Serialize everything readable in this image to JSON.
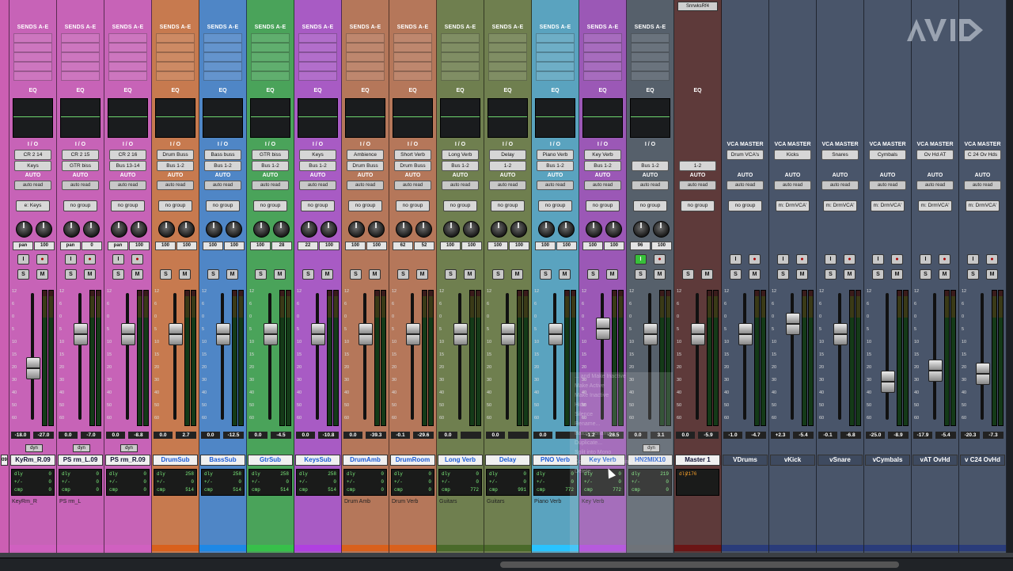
{
  "sends_label": "SENDS A-E",
  "eq_label": "EQ",
  "io_label": "I / O",
  "auto_label": "AUTO",
  "vca_master_label": "VCA MASTER",
  "solo_label": "S",
  "mute_label": "M",
  "dly_label": "dly",
  "pd_label": "+/-",
  "cmp_label": "cmp",
  "insert_label": "SnrwksRf4",
  "dyn_label": "dyn",
  "scale": [
    "12",
    "6",
    "0",
    "5",
    "10",
    "15",
    "20",
    "30",
    "40",
    "50",
    "60"
  ],
  "strips": [
    {
      "name": "09",
      "color": "#cc5fb3",
      "name_bg": "#f0f0f0",
      "kind": "partial"
    },
    {
      "name": "KyRm_R.09",
      "color": "#c763b7",
      "io": [
        "CR 2 14",
        "Keys"
      ],
      "auto": "auto read",
      "group": "e: Keys",
      "pan": [
        "pan",
        "100"
      ],
      "vol": [
        "-18.0",
        "-27.0"
      ],
      "fader": 0.58,
      "dly": [
        "dly",
        "0",
        "+/-",
        "0",
        "cmp",
        "0"
      ],
      "comment": "KeyRm_R",
      "bar": "#d060c0",
      "dyn": true
    },
    {
      "name": "PS rm_L.09",
      "color": "#c763b7",
      "io": [
        "CR 2 15",
        "GTR biss"
      ],
      "auto": "auto read",
      "group": "no group",
      "pan": [
        "pan",
        "0"
      ],
      "vol": [
        "0.0",
        "-7.0"
      ],
      "fader": 0.27,
      "dly": [
        "dly",
        "0",
        "+/-",
        "0",
        "cmp",
        "0"
      ],
      "comment": "PS rm_L",
      "bar": "#d060c0",
      "dyn": true
    },
    {
      "name": "PS rm_R.09",
      "color": "#c763b7",
      "io": [
        "CR 2 16",
        "Bus 13-14"
      ],
      "auto": "auto read",
      "group": "no group",
      "pan": [
        "pan",
        "100"
      ],
      "vol": [
        "0.0",
        "-8.8"
      ],
      "fader": 0.27,
      "dly": [
        "dly",
        "0",
        "+/-",
        "0",
        "cmp",
        "0"
      ],
      "comment": "",
      "bar": "#d060c0",
      "dyn": true
    },
    {
      "name": "DrumSub",
      "color": "#c77a4f",
      "io": [
        "Drum Buss",
        "Bus 1-2"
      ],
      "auto": "auto read",
      "group": "no group",
      "pan": [
        "100",
        "100"
      ],
      "vol": [
        "0.0",
        "2.7"
      ],
      "fader": 0.27,
      "dly": [
        "dly",
        "258",
        "+/-",
        "0",
        "cmp",
        "514"
      ],
      "comment": "",
      "bar": "#d9601c"
    },
    {
      "name": "BassSub",
      "color": "#4f86c6",
      "io": [
        "Bass buss",
        "Bus 1-2"
      ],
      "auto": "auto read",
      "group": "no group",
      "pan": [
        "100",
        "100"
      ],
      "vol": [
        "0.0",
        "-12.5"
      ],
      "fader": 0.27,
      "dly": [
        "dly",
        "258",
        "+/-",
        "0",
        "cmp",
        "514"
      ],
      "comment": "",
      "bar": "#1e88e5"
    },
    {
      "name": "GtrSub",
      "color": "#4aa35a",
      "io": [
        "GTR biss",
        "Bus 1-2"
      ],
      "auto": "auto read",
      "group": "no group",
      "pan": [
        "100",
        "28"
      ],
      "vol": [
        "0.0",
        "-4.5"
      ],
      "fader": 0.27,
      "dly": [
        "dly",
        "258",
        "+/-",
        "0",
        "cmp",
        "514"
      ],
      "comment": "",
      "bar": "#37c04a"
    },
    {
      "name": "KeysSub",
      "color": "#a85bc4",
      "io": [
        "Keys",
        "Bus 1-2"
      ],
      "auto": "auto read",
      "group": "no group",
      "pan": [
        "22",
        "100"
      ],
      "vol": [
        "0.0",
        "-10.8"
      ],
      "fader": 0.27,
      "dly": [
        "dly",
        "258",
        "+/-",
        "0",
        "cmp",
        "514"
      ],
      "comment": "",
      "bar": "#b040e0"
    },
    {
      "name": "DrumAmb",
      "color": "#b5775a",
      "io": [
        "Ambience",
        "Drum Buss"
      ],
      "auto": "auto read",
      "group": "no group",
      "pan": [
        "100",
        "100"
      ],
      "vol": [
        "0.0",
        "-39.3"
      ],
      "fader": 0.27,
      "dly": [
        "dly",
        "0",
        "+/-",
        "0",
        "cmp",
        "0"
      ],
      "comment": "Drum Amb",
      "bar": "#d9601c"
    },
    {
      "name": "DrumRoom",
      "color": "#b5775a",
      "io": [
        "Short Verb",
        "Drum Buss"
      ],
      "auto": "auto read",
      "group": "no group",
      "pan": [
        "62",
        "52"
      ],
      "vol": [
        "-0.1",
        "-29.6"
      ],
      "fader": 0.27,
      "dly": [
        "dly",
        "0",
        "+/-",
        "0",
        "cmp",
        "0"
      ],
      "comment": "Drum Verb",
      "bar": "#d9601c"
    },
    {
      "name": "Long Verb",
      "color": "#6f7f4f",
      "io": [
        "Long Verb",
        "Bus 1-2"
      ],
      "auto": "auto read",
      "group": "no group",
      "pan": [
        "100",
        "100"
      ],
      "vol": [
        "0.0",
        ""
      ],
      "fader": 0.27,
      "dly": [
        "dly",
        "0",
        "+/-",
        "0",
        "cmp",
        "772"
      ],
      "comment": "Guitars",
      "bar": "#4a6a2a"
    },
    {
      "name": "Delay",
      "color": "#6f7f4f",
      "io": [
        "Delay",
        "1-2"
      ],
      "auto": "auto read",
      "group": "no group",
      "pan": [
        "100",
        "100"
      ],
      "vol": [
        "0.0",
        ""
      ],
      "fader": 0.27,
      "dly": [
        "dly",
        "0",
        "+/-",
        "0",
        "cmp",
        "991"
      ],
      "comment": "Guitars",
      "bar": "#4a6a2a"
    },
    {
      "name": "PNO Verb",
      "color": "#5aa3bf",
      "io": [
        "Piano Verb",
        "Bus 1-2"
      ],
      "auto": "auto read",
      "group": "no group",
      "pan": [
        "100",
        "100"
      ],
      "vol": [
        "0.0",
        ""
      ],
      "fader": 0.27,
      "dly": [
        "dly",
        "0",
        "+/-",
        "0",
        "cmp",
        "772"
      ],
      "comment": "Piano Verb",
      "bar": "#29c3ff"
    },
    {
      "name": "Key Verb",
      "color": "#9b58b6",
      "io": [
        "Key Verb",
        "Bus 1-2"
      ],
      "auto": "auto read",
      "group": "no group",
      "pan": [
        "100",
        "100"
      ],
      "vol": [
        "-1.2",
        "-28.5"
      ],
      "fader": 0.22,
      "dly": [
        "dly",
        "0",
        "+/-",
        "0",
        "cmp",
        "772"
      ],
      "comment": "Key Verb",
      "bar": "#b040e0"
    },
    {
      "name": "HN2MIX10",
      "color": "#56606b",
      "io": [
        "",
        "Bus 1-2"
      ],
      "auto": "auto read",
      "group": "no group",
      "pan": [
        "96",
        "100"
      ],
      "vol": [
        "0.0",
        "3.1"
      ],
      "fader": 0.27,
      "dly": [
        "dly",
        "219",
        "+/-",
        "0",
        "cmp",
        "0"
      ],
      "comment": "",
      "bar": "#5a5f66",
      "dyn": true,
      "insert": true
    },
    {
      "name": "Master 1",
      "color": "#5e3a3a",
      "io": [
        "",
        "1-2"
      ],
      "auto": "auto read",
      "group": "no group",
      "pan": null,
      "vol": [
        "0.0",
        "-5.9"
      ],
      "fader": 0.27,
      "dly": [
        "dly",
        "2176"
      ],
      "comment": "",
      "bar": "#6b1515",
      "master": true
    },
    {
      "name": "VDrums",
      "color": "#4a566b",
      "io": [
        "Drum VCA's",
        ""
      ],
      "auto": "auto read",
      "group": "no group",
      "vca": true,
      "vol": [
        "-1.0",
        "-4.7"
      ],
      "fader": 0.27,
      "comment": "",
      "bar": "#2a3c7a"
    },
    {
      "name": "vKick",
      "color": "#4a566b",
      "io": [
        "Kicks",
        ""
      ],
      "auto": "auto read",
      "group": "m: DrmVCA'",
      "vca": true,
      "vol": [
        "+2.3",
        "-5.4"
      ],
      "fader": 0.18,
      "comment": "",
      "bar": "#2a3c7a"
    },
    {
      "name": "vSnare",
      "color": "#4a566b",
      "io": [
        "Snares",
        ""
      ],
      "auto": "auto read",
      "group": "m: DrmVCA'",
      "vca": true,
      "vol": [
        "-0.1",
        "-6.8"
      ],
      "fader": 0.27,
      "comment": "",
      "bar": "#2a3c7a"
    },
    {
      "name": "vCymbals",
      "color": "#4a566b",
      "io": [
        "Cymbals",
        ""
      ],
      "auto": "auto read",
      "group": "m: DrmVCA'",
      "vca": true,
      "vol": [
        "-25.0",
        "-8.9"
      ],
      "fader": 0.7,
      "comment": "",
      "bar": "#2a3c7a"
    },
    {
      "name": "vAT OvHd",
      "color": "#4a566b",
      "io": [
        "Ov Hd AT",
        ""
      ],
      "auto": "auto read",
      "group": "m: DrmVCA'",
      "vca": true,
      "vol": [
        "-17.9",
        "-5.4"
      ],
      "fader": 0.6,
      "comment": "",
      "bar": "#2a3c7a"
    },
    {
      "name": "v C24 OvHd",
      "color": "#4a566b",
      "io": [
        "C 24 Ov Hds",
        ""
      ],
      "auto": "auto read",
      "group": "m: DrmVCA'",
      "vca": true,
      "vol": [
        "-20.3",
        "-7.3"
      ],
      "fader": 0.63,
      "comment": "",
      "bar": "#2a3c7a"
    }
  ],
  "ghost_menu": [
    "... and Make Inactive",
    "Make Active",
    "Make Inactive",
    "Hide",
    "Silence",
    "Rename...",
    "Batch Rename...",
    "Duplicate...",
    "Split into Mono",
    "Convert Aux to Routing Folder",
    "Delete"
  ],
  "logo": "AVID"
}
